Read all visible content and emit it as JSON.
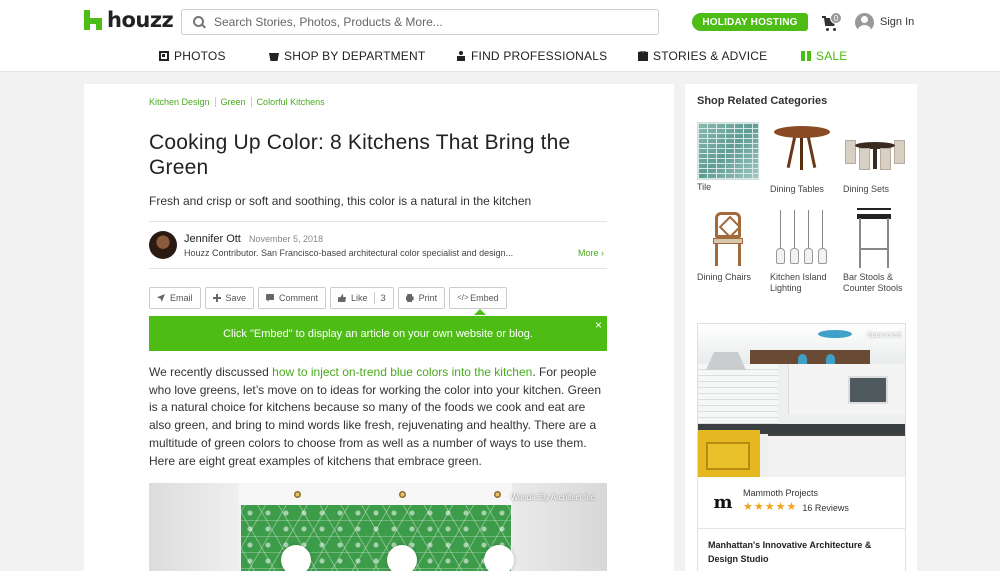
{
  "header": {
    "logo_text": "houzz",
    "search_placeholder": "Search Stories, Photos, Products & More...",
    "holiday_label": "HOLIDAY HOSTING",
    "cart_count": "0",
    "signin_label": "Sign In",
    "accent_color": "#4dbc15"
  },
  "nav": {
    "items": [
      {
        "label": "PHOTOS",
        "icon": "photos-icon"
      },
      {
        "label": "SHOP BY DEPARTMENT",
        "icon": "shop-icon"
      },
      {
        "label": "FIND PROFESSIONALS",
        "icon": "professional-icon"
      },
      {
        "label": "STORIES & ADVICE",
        "icon": "stories-icon"
      },
      {
        "label": "SALE",
        "icon": "gift-icon"
      }
    ]
  },
  "article": {
    "breadcrumbs": [
      "Kitchen Design",
      "Green",
      "Colorful Kitchens"
    ],
    "title": "Cooking Up Color: 8 Kitchens That Bring the Green",
    "subtitle": "Fresh and crisp or soft and soothing, this color is a natural in the kitchen",
    "author": {
      "name": "Jennifer Ott",
      "date": "November 5, 2018",
      "bio": "Houzz Contributor. San Francisco-based architectural color specialist and design...",
      "more_label": "More ›"
    },
    "actions": {
      "email": "Email",
      "save": "Save",
      "comment": "Comment",
      "like": "Like",
      "like_count": "3",
      "print": "Print",
      "embed": "Embed"
    },
    "embed_banner": "Click \"Embed\" to display an article on your own website or blog.",
    "banner_close": "×",
    "body_before": "We recently discussed ",
    "body_link": "how to inject on-trend blue colors into the kitchen",
    "body_after": ". For people who love greens, let’s move on to ideas for working the color into your kitchen. Green is a natural choice for kitchens because so many of the foods we cook and eat are also green, and bring to mind words like fresh, rejuvenating and healthy. There are a multitude of green colors to choose from as well as a number of ways to use them. Here are eight great examples of kitchens that embrace green.",
    "image_credit": "Wanda Ely Architect Inc."
  },
  "sidebar": {
    "title": "Shop Related Categories",
    "categories": [
      {
        "label": "Tile"
      },
      {
        "label": "Dining Tables"
      },
      {
        "label": "Dining Sets"
      },
      {
        "label": "Dining Chairs"
      },
      {
        "label": "Kitchen Island Lighting"
      },
      {
        "label": "Bar Stools & Counter Stools"
      }
    ],
    "ad": {
      "sponsored_label": "Sponsored",
      "logo_letter": "m",
      "company": "Mammoth Projects",
      "rating": 5,
      "reviews": "16 Reviews",
      "description": "Manhattan's Innovative Architecture & Design Studio",
      "star_color": "#f3a21b"
    }
  }
}
